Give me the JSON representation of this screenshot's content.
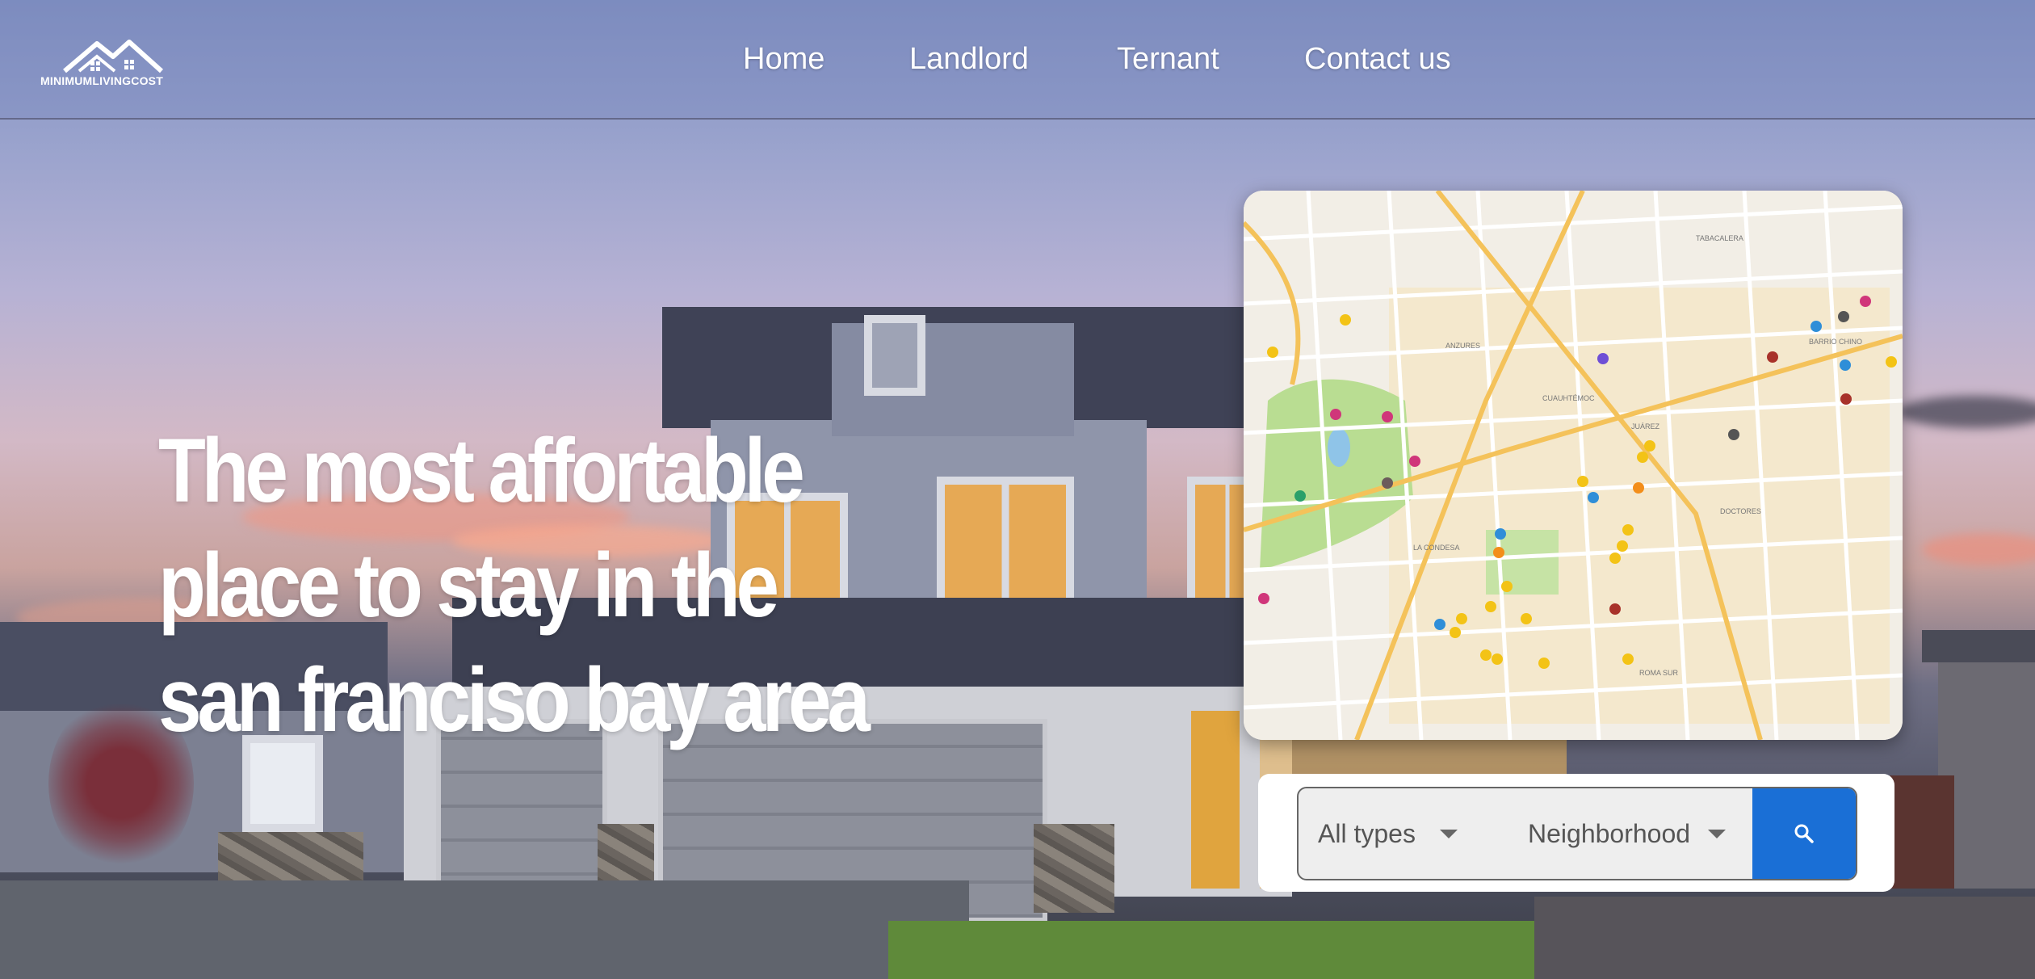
{
  "brand": {
    "logo_text": "MINIMUMLIVINGCOST",
    "logo_icon": "house-roof-logo-icon"
  },
  "nav": {
    "items": [
      {
        "label": "Home"
      },
      {
        "label": "Landlord"
      },
      {
        "label": "Ternant"
      },
      {
        "label": "Contact us"
      }
    ]
  },
  "hero": {
    "lines": [
      "The most affortable",
      "place to stay in the",
      "san franciso bay area"
    ]
  },
  "map": {
    "icon": "city-map-image"
  },
  "search": {
    "type_select": "All types",
    "neighborhood_select": "Neighborhood",
    "button_icon": "search-icon"
  },
  "colors": {
    "accent": "#1a6fd6",
    "text": "#ffffff"
  }
}
